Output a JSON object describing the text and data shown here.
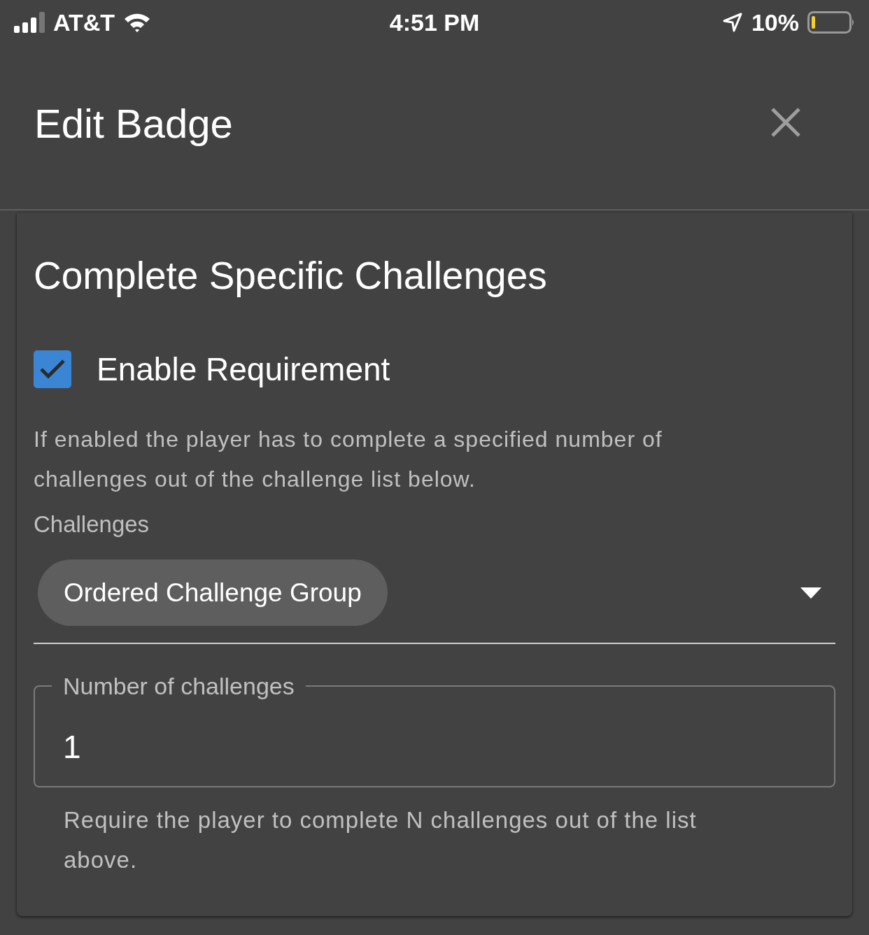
{
  "status_bar": {
    "carrier": "AT&T",
    "time": "4:51 PM",
    "battery": "10%"
  },
  "dialog": {
    "title": "Edit Badge"
  },
  "section": {
    "title": "Complete Specific Challenges",
    "checkbox": {
      "label": "Enable Requirement",
      "checked": true
    },
    "description": "If enabled the player has to complete a specified number of challenges out of the challenge list below.",
    "challenges": {
      "label": "Challenges",
      "chips": [
        "Ordered Challenge Group"
      ]
    },
    "number_field": {
      "label": "Number of challenges",
      "value": "1",
      "helper": "Require the player to complete N challenges out of the list above."
    }
  }
}
